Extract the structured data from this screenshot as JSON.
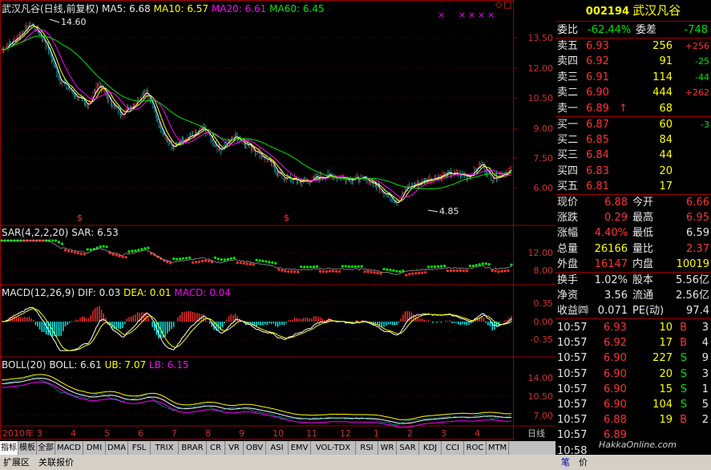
{
  "chart_header": {
    "title": "武汉凡谷(日线,前复权)",
    "ma5": "MA5: 6.68",
    "ma10": "MA10: 6.57",
    "ma20": "MA20: 6.61",
    "ma60": "MA60: 6.45"
  },
  "main_chart": {
    "y_ticks": [
      "13.50",
      "12.00",
      "10.50",
      "9.00",
      "7.50",
      "6.00"
    ],
    "high_label": "14.60",
    "low_label": "4.85",
    "markers": [
      "$",
      "$"
    ]
  },
  "sar": {
    "header_name": "SAR(4,2,2,20)",
    "header_value": "SAR: 6.53",
    "y_ticks": [
      "12.00",
      "8.00"
    ]
  },
  "macd": {
    "header_name": "MACD(12,26,9)",
    "dif": "DIF: 0.03",
    "dea": "DEA: 0.01",
    "macd": "MACD: 0.04",
    "y_ticks": [
      "0.35",
      "0.00",
      "-0.35"
    ]
  },
  "boll": {
    "header_name": "BOLL(20)",
    "boll": "BOLL: 6.61",
    "ub": "UB: 7.07",
    "lb": "LB: 6.15",
    "y_ticks": [
      "14.00",
      "10.50",
      "7.00"
    ]
  },
  "x_axis": {
    "year_label": "2010年",
    "months": [
      "3",
      "4",
      "5",
      "6",
      "7",
      "8",
      "9",
      "10",
      "11",
      "12",
      "1",
      "2",
      "3",
      "4"
    ],
    "period": "日线"
  },
  "tabs": [
    "指标",
    "模板",
    "全部",
    "MACD",
    "DMI",
    "DMA",
    "FSL",
    "TRIX",
    "BRAR",
    "CR",
    "VR",
    "OBV",
    "ASI",
    "EMV",
    "VOL-TDX",
    "RSI",
    "WR",
    "SAR",
    "KDJ",
    "CCI",
    "ROC",
    "MTM"
  ],
  "status_bar": {
    "btn1": "扩展区",
    "btn2": "关联报价",
    "right_btn1": "笔",
    "right_btn2": "价"
  },
  "quote": {
    "code": "002194",
    "name": "武汉凡谷",
    "weibi_label": "委比",
    "weibi": "-62.44%",
    "weicha_label": "委差",
    "weicha": "-748",
    "asks": [
      {
        "label": "卖五",
        "price": "6.93",
        "vol": "256",
        "chg": "+256"
      },
      {
        "label": "卖四",
        "price": "6.92",
        "vol": "91",
        "chg": "-25"
      },
      {
        "label": "卖三",
        "price": "6.91",
        "vol": "114",
        "chg": "-44"
      },
      {
        "label": "卖二",
        "price": "6.90",
        "vol": "444",
        "chg": "+262"
      },
      {
        "label": "卖一",
        "price": "6.89",
        "vol": "68",
        "chg": ""
      }
    ],
    "bids": [
      {
        "label": "买一",
        "price": "6.87",
        "vol": "60",
        "chg": "-3"
      },
      {
        "label": "买二",
        "price": "6.85",
        "vol": "84",
        "chg": ""
      },
      {
        "label": "买三",
        "price": "6.84",
        "vol": "44",
        "chg": ""
      },
      {
        "label": "买四",
        "price": "6.83",
        "vol": "20",
        "chg": ""
      },
      {
        "label": "买五",
        "price": "6.81",
        "vol": "17",
        "chg": ""
      }
    ],
    "stats": [
      {
        "l1": "现价",
        "v1": "6.88",
        "l2": "今开",
        "v2": "6.66"
      },
      {
        "l1": "涨跌",
        "v1": "0.29",
        "l2": "最高",
        "v2": "6.95"
      },
      {
        "l1": "涨幅",
        "v1": "4.40%",
        "l2": "最低",
        "v2": "6.59"
      },
      {
        "l1": "总量",
        "v1": "26166",
        "l2": "量比",
        "v2": "2.37"
      },
      {
        "l1": "外盘",
        "v1": "16147",
        "l2": "内盘",
        "v2": "10019"
      }
    ],
    "fund": [
      {
        "l1": "换手",
        "v1": "1.02%",
        "l2": "股本",
        "v2": "5.56亿"
      },
      {
        "l1": "净资",
        "v1": "3.56",
        "l2": "流通",
        "v2": "2.56亿"
      },
      {
        "l1": "收益㈣",
        "v1": "0.071",
        "l2": "PE(动)",
        "v2": "97.4"
      }
    ],
    "ticks": [
      {
        "t": "10:57",
        "p": "6.93",
        "v": "10",
        "s": "B",
        "n": "3"
      },
      {
        "t": "10:57",
        "p": "6.92",
        "v": "17",
        "s": "B",
        "n": "4"
      },
      {
        "t": "10:57",
        "p": "6.90",
        "v": "227",
        "s": "S",
        "n": "9"
      },
      {
        "t": "10:57",
        "p": "6.90",
        "v": "20",
        "s": "S",
        "n": "3"
      },
      {
        "t": "10:57",
        "p": "6.90",
        "v": "15",
        "s": "S",
        "n": "1"
      },
      {
        "t": "10:57",
        "p": "6.90",
        "v": "104",
        "s": "S",
        "n": "5"
      },
      {
        "t": "10:57",
        "p": "6.88",
        "v": "19",
        "s": "B",
        "n": "2"
      },
      {
        "t": "10:57",
        "p": "6.89",
        "v": "",
        "s": "",
        "n": ""
      },
      {
        "t": "10:58",
        "p": "",
        "v": "",
        "s": "",
        "n": ""
      }
    ],
    "watermark": "HakkaOnline.com"
  }
}
